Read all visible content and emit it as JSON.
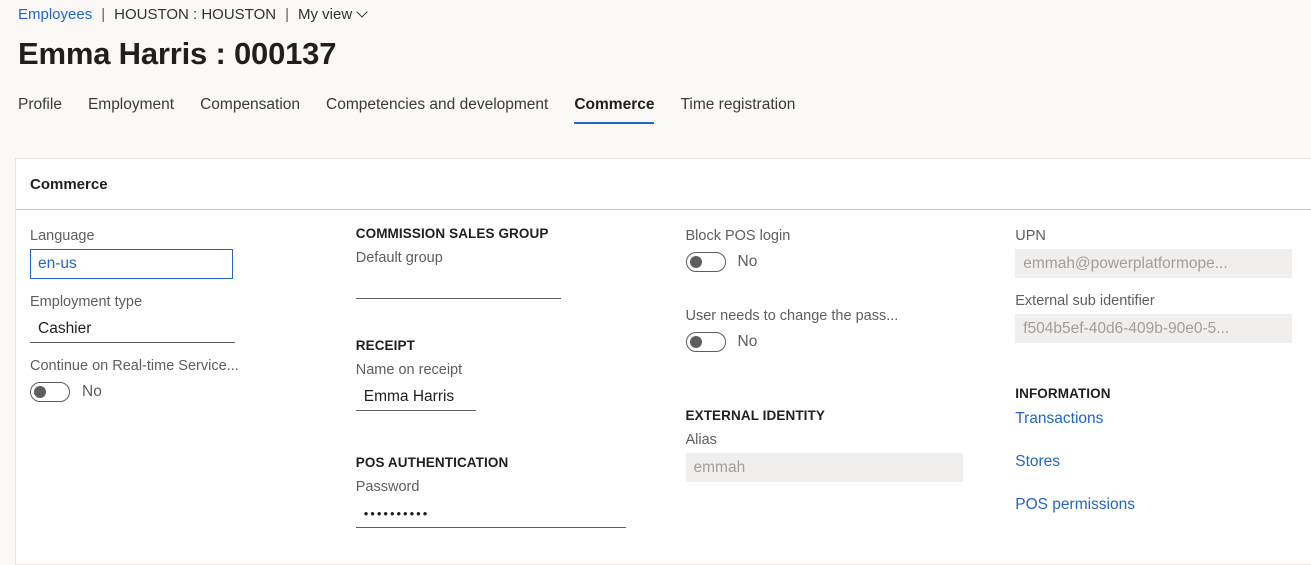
{
  "breadcrumb": {
    "link": "Employees",
    "separator": "|",
    "legal_entity": "HOUSTON : HOUSTON",
    "view": "My view"
  },
  "page_title": "Emma Harris : 000137",
  "tabs": [
    {
      "label": "Profile",
      "active": false
    },
    {
      "label": "Employment",
      "active": false
    },
    {
      "label": "Compensation",
      "active": false
    },
    {
      "label": "Competencies and development",
      "active": false
    },
    {
      "label": "Commerce",
      "active": true
    },
    {
      "label": "Time registration",
      "active": false
    }
  ],
  "card": {
    "header": "Commerce",
    "col1": {
      "language_label": "Language",
      "language_value": "en-us",
      "employment_type_label": "Employment type",
      "employment_type_value": "Cashier",
      "realtime_label": "Continue on Real-time Service...",
      "realtime_value": "No"
    },
    "col2": {
      "commission_group_title": "COMMISSION SALES GROUP",
      "commission_group_label": "Default group",
      "commission_group_value": "",
      "receipt_title": "RECEIPT",
      "name_on_receipt_label": "Name on receipt",
      "name_on_receipt_value": "Emma Harris",
      "pos_auth_title": "POS AUTHENTICATION",
      "password_label": "Password",
      "password_value": "••••••••••"
    },
    "col3": {
      "block_pos_label": "Block POS login",
      "block_pos_value": "No",
      "change_pass_label": "User needs to change the pass...",
      "change_pass_value": "No",
      "external_identity_title": "EXTERNAL IDENTITY",
      "alias_label": "Alias",
      "alias_value": "emmah"
    },
    "col4": {
      "upn_label": "UPN",
      "upn_value": "emmah@powerplatformope...",
      "external_sub_label": "External sub identifier",
      "external_sub_value": "f504b5ef-40d6-409b-90e0-5...",
      "information_title": "INFORMATION",
      "links": [
        "Transactions",
        "Stores",
        "POS permissions"
      ]
    }
  },
  "colors": {
    "accent": "#2266cc",
    "page_bg": "#faf9f8",
    "card_bg": "#ffffff",
    "readonly_bg": "#f0efee",
    "label": "#605e5c"
  }
}
